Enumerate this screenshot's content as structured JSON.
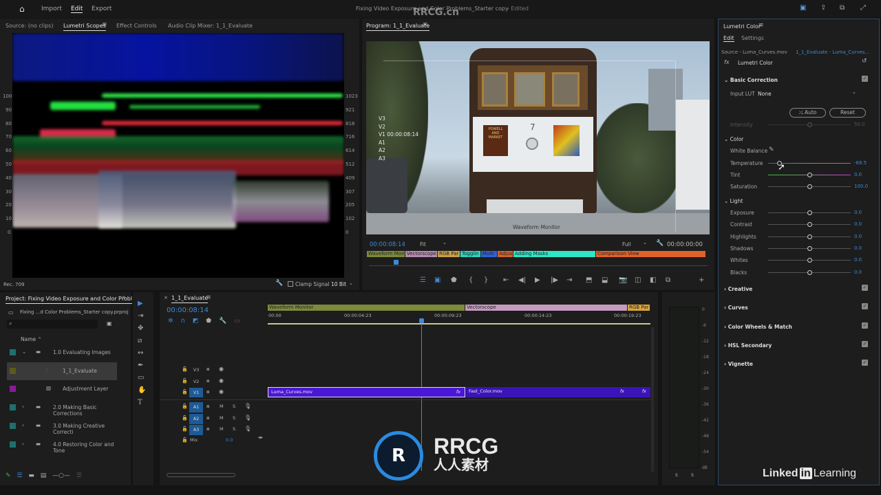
{
  "topbar": {
    "nav": [
      "Import",
      "Edit",
      "Export"
    ],
    "active": "Edit",
    "title": "Fixing Video Exposure and Color Problems_Starter copy",
    "edited": "- Edited"
  },
  "scopes": {
    "tabs": [
      "Source: (no clips)",
      "Lumetri Scopes",
      "Effect Controls",
      "Audio Clip Mixer: 1_1_Evaluate"
    ],
    "active": "Lumetri Scopes",
    "left_axis": [
      "100",
      "90",
      "80",
      "70",
      "60",
      "50",
      "40",
      "30",
      "20",
      "10",
      "0"
    ],
    "right_axis": [
      "1023",
      "921",
      "818",
      "716",
      "614",
      "512",
      "409",
      "307",
      "205",
      "102",
      "0"
    ],
    "color_space": "Rec. 709",
    "clamp_label": "Clamp Signal",
    "clamp_checked": false,
    "bit_depth": "10 Bit"
  },
  "program": {
    "title": "Program: 1_1_Evaluate",
    "overlay_tracks": [
      "V3",
      "V2",
      "V1 00:00:08:14",
      "A1",
      "A2",
      "A3"
    ],
    "overlay_marker": "Waveform Monitor",
    "timecode": "00:00:08:14",
    "fit": "Fit",
    "quality": "Full",
    "duration": "00:00:00:00",
    "markers": [
      {
        "label": "Waveform Mon",
        "color": "#7d8a3a"
      },
      {
        "label": "Vectorscope",
        "color": "#b48bb0"
      },
      {
        "label": "RGB Par",
        "color": "#c9a04a"
      },
      {
        "label": "Togglin",
        "color": "#2fd3c0"
      },
      {
        "label": "Multi",
        "color": "#2f62d8"
      },
      {
        "label": "Adjus",
        "color": "#d2642c"
      },
      {
        "label": "Adding Masks",
        "color": "#2fe6c8"
      },
      {
        "label": "Comparison View",
        "color": "#e0622a"
      }
    ],
    "sign": [
      "POWELL",
      "AND",
      "MARKET"
    ],
    "car_number": "7"
  },
  "lumetri": {
    "title": "Lumetri Color",
    "tabs": [
      "Edit",
      "Settings"
    ],
    "source": "Source - Luma_Curves.mov",
    "sequence": "1_1_Evaluate - Luma_Curves...",
    "effect": "Lumetri Color",
    "basic": {
      "label": "Basic Correction",
      "input_lut_label": "Input LUT",
      "input_lut": "None",
      "auto": "Auto",
      "reset": "Reset",
      "intensity_label": "Intensity",
      "intensity": "50.0",
      "color_label": "Color",
      "white_balance": "White Balance",
      "color_rows": [
        {
          "label": "Temperature",
          "value": "-68.5",
          "pos": 0.13
        },
        {
          "label": "Tint",
          "value": "0.0",
          "pos": 0.5
        },
        {
          "label": "Saturation",
          "value": "100.0",
          "pos": 0.5
        }
      ],
      "light_label": "Light",
      "light_rows": [
        {
          "label": "Exposure",
          "value": "0.0"
        },
        {
          "label": "Contrast",
          "value": "0.0"
        },
        {
          "label": "Highlights",
          "value": "0.0"
        },
        {
          "label": "Shadows",
          "value": "0.0"
        },
        {
          "label": "Whites",
          "value": "0.0"
        },
        {
          "label": "Blacks",
          "value": "0.0"
        }
      ]
    },
    "sections": [
      "Creative",
      "Curves",
      "Color Wheels & Match",
      "HSL Secondary",
      "Vignette"
    ]
  },
  "project": {
    "title": "Project: Fixing Video Exposure and Color Probl",
    "file": "Fixing ...d Color Problems_Starter copy.prproj",
    "column": "Name",
    "items": [
      {
        "label": "1.0 Evaluating Images",
        "color": "#1f6f6f",
        "type": "folder",
        "expanded": true
      },
      {
        "label": "1_1_Evaluate",
        "color": "#5a5a1a",
        "type": "sequence",
        "selected": true
      },
      {
        "label": "Adjustment Layer",
        "color": "#8a1a9a",
        "type": "file"
      },
      {
        "label": "2.0 Making Basic Corrections",
        "color": "#1f6f6f",
        "type": "folder"
      },
      {
        "label": "3.0 Making Creative Correcti",
        "color": "#1f6f6f",
        "type": "folder"
      },
      {
        "label": "4.0 Restoring Color and Tone",
        "color": "#1f6f6f",
        "type": "folder"
      }
    ]
  },
  "timeline": {
    "title": "1_1_Evaluate",
    "timecode": "00:00:08:14",
    "ruler": [
      "00:00",
      "00:00:04:23",
      "00:00:09:23",
      "00:00:14:23",
      "00:00:19:23"
    ],
    "markers": [
      {
        "label": "Waveform Monitor",
        "color": "#7d8a3a"
      },
      {
        "label": "Vectorscope",
        "color": "#c39bc0"
      },
      {
        "label": "RGB Par",
        "color": "#d9a53a"
      }
    ],
    "video_tracks": [
      "V3",
      "V2",
      "V1"
    ],
    "audio_tracks": [
      "A1",
      "A2",
      "A3"
    ],
    "mix_label": "Mix",
    "mix_value": "0.0",
    "clips": [
      "Luma_Curves.mov",
      "Fast_Color.mov"
    ],
    "fx": "fx",
    "audio_buttons": [
      "M",
      "S"
    ]
  },
  "meter": {
    "ticks": [
      "0",
      "-6",
      "-12",
      "-18",
      "-24",
      "-30",
      "-36",
      "-42",
      "-48",
      "-54",
      "dB"
    ],
    "solo": [
      "S",
      "S"
    ]
  },
  "branding": {
    "linkedin": "Linked",
    "in": "in",
    "learning": "Learning",
    "watermark": "RRCG",
    "watermark_sub": "人人素材",
    "watermark_url": "RRCG.cn"
  },
  "accent": "#3d8ad6"
}
